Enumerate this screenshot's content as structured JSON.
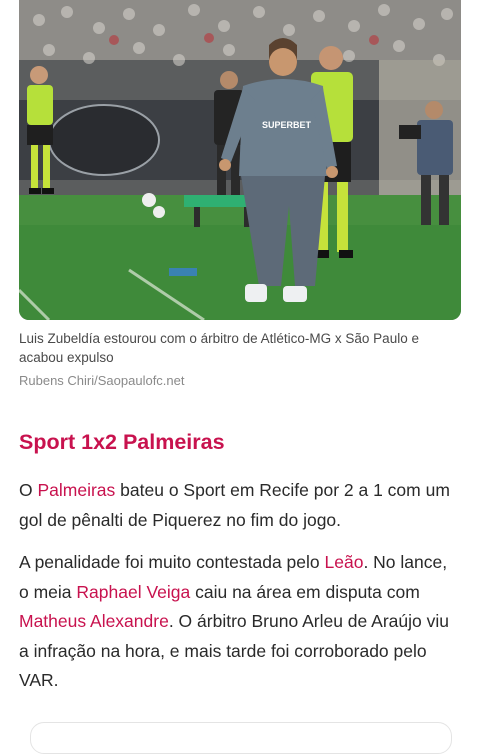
{
  "photo": {
    "alt": "Luis Zubeldía no gramado com árbitros ao fundo",
    "shirt_text": "SUPERBET"
  },
  "caption": "Luis Zubeldía estourou com o árbitro de Atlético-MG x São Paulo e acabou expulso",
  "credit": "Rubens Chiri/Saopaulofc.net",
  "headline": "Sport 1x2 Palmeiras",
  "paragraph1": {
    "pre": "O ",
    "link1": "Palmeiras",
    "post": " bateu o Sport em Recife por 2 a 1 com um gol de pênalti de Piquerez no fim do jogo."
  },
  "paragraph2": {
    "t1": "A penalidade foi muito contestada pelo ",
    "link1": "Leão",
    "t2": ". No lance, o meia ",
    "link2": "Raphael Veiga",
    "t3": " caiu na área em disputa com ",
    "link3": "Matheus Alexandre",
    "t4": ". O árbitro Bruno Arleu de Araújo viu a infração na hora, e mais tarde foi corroborado pelo VAR."
  },
  "colors": {
    "accent": "#c8124e",
    "pitch": "#3f8a3a",
    "referee_kit": "#b6e03a"
  }
}
